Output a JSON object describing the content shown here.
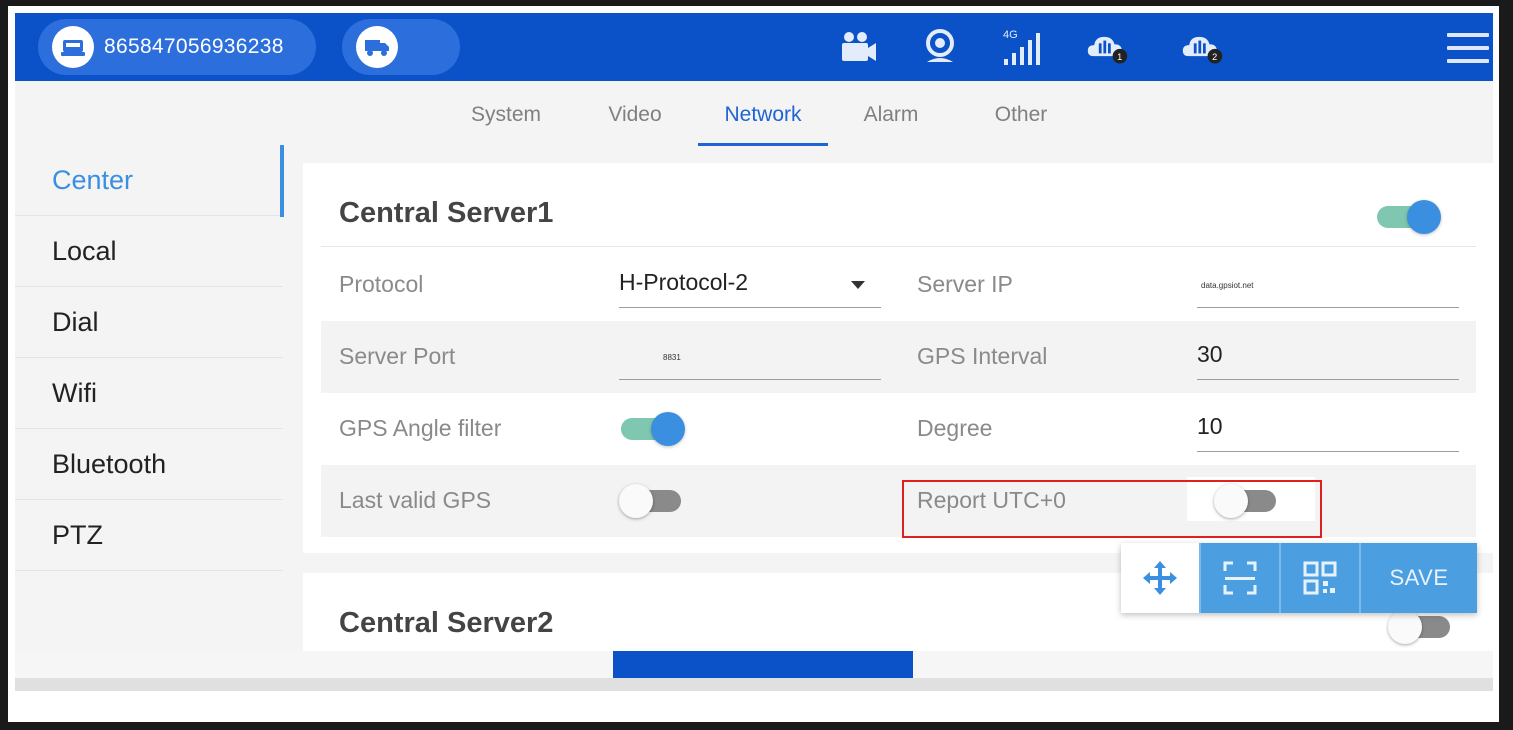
{
  "header": {
    "device_id": "865847056936238",
    "status_icons": [
      "video-camera-icon",
      "webcam-icon",
      "signal-4g-icon",
      "cloud-server-1-icon",
      "cloud-server-2-icon"
    ],
    "signal_label": "4G",
    "cloud1_badge": "1",
    "cloud2_badge": "2"
  },
  "tabs": [
    {
      "label": "System",
      "active": false
    },
    {
      "label": "Video",
      "active": false
    },
    {
      "label": "Network",
      "active": true
    },
    {
      "label": "Alarm",
      "active": false
    },
    {
      "label": "Other",
      "active": false
    }
  ],
  "sidebar": {
    "items": [
      {
        "label": "Center",
        "active": true
      },
      {
        "label": "Local",
        "active": false
      },
      {
        "label": "Dial",
        "active": false
      },
      {
        "label": "Wifi",
        "active": false
      },
      {
        "label": "Bluetooth",
        "active": false
      },
      {
        "label": "PTZ",
        "active": false
      }
    ]
  },
  "server1": {
    "title": "Central Server1",
    "enabled": true,
    "protocol_label": "Protocol",
    "protocol_value": "H-Protocol-2",
    "server_ip_label": "Server IP",
    "server_ip_value": "data.gpsiot.net",
    "server_port_label": "Server Port",
    "server_port_value": "8831",
    "gps_interval_label": "GPS Interval",
    "gps_interval_value": "30",
    "gps_angle_label": "GPS Angle filter",
    "gps_angle_enabled": true,
    "degree_label": "Degree",
    "degree_value": "10",
    "last_valid_gps_label": "Last valid GPS",
    "last_valid_gps_enabled": false,
    "report_utc_label": "Report UTC+0",
    "report_utc_enabled": false
  },
  "server2": {
    "title": "Central Server2",
    "enabled": false
  },
  "toolbar": {
    "save_label": "SAVE"
  },
  "colors": {
    "header_bg": "#0b52c8",
    "accent": "#3b8fe0",
    "highlight": "#e02020"
  }
}
